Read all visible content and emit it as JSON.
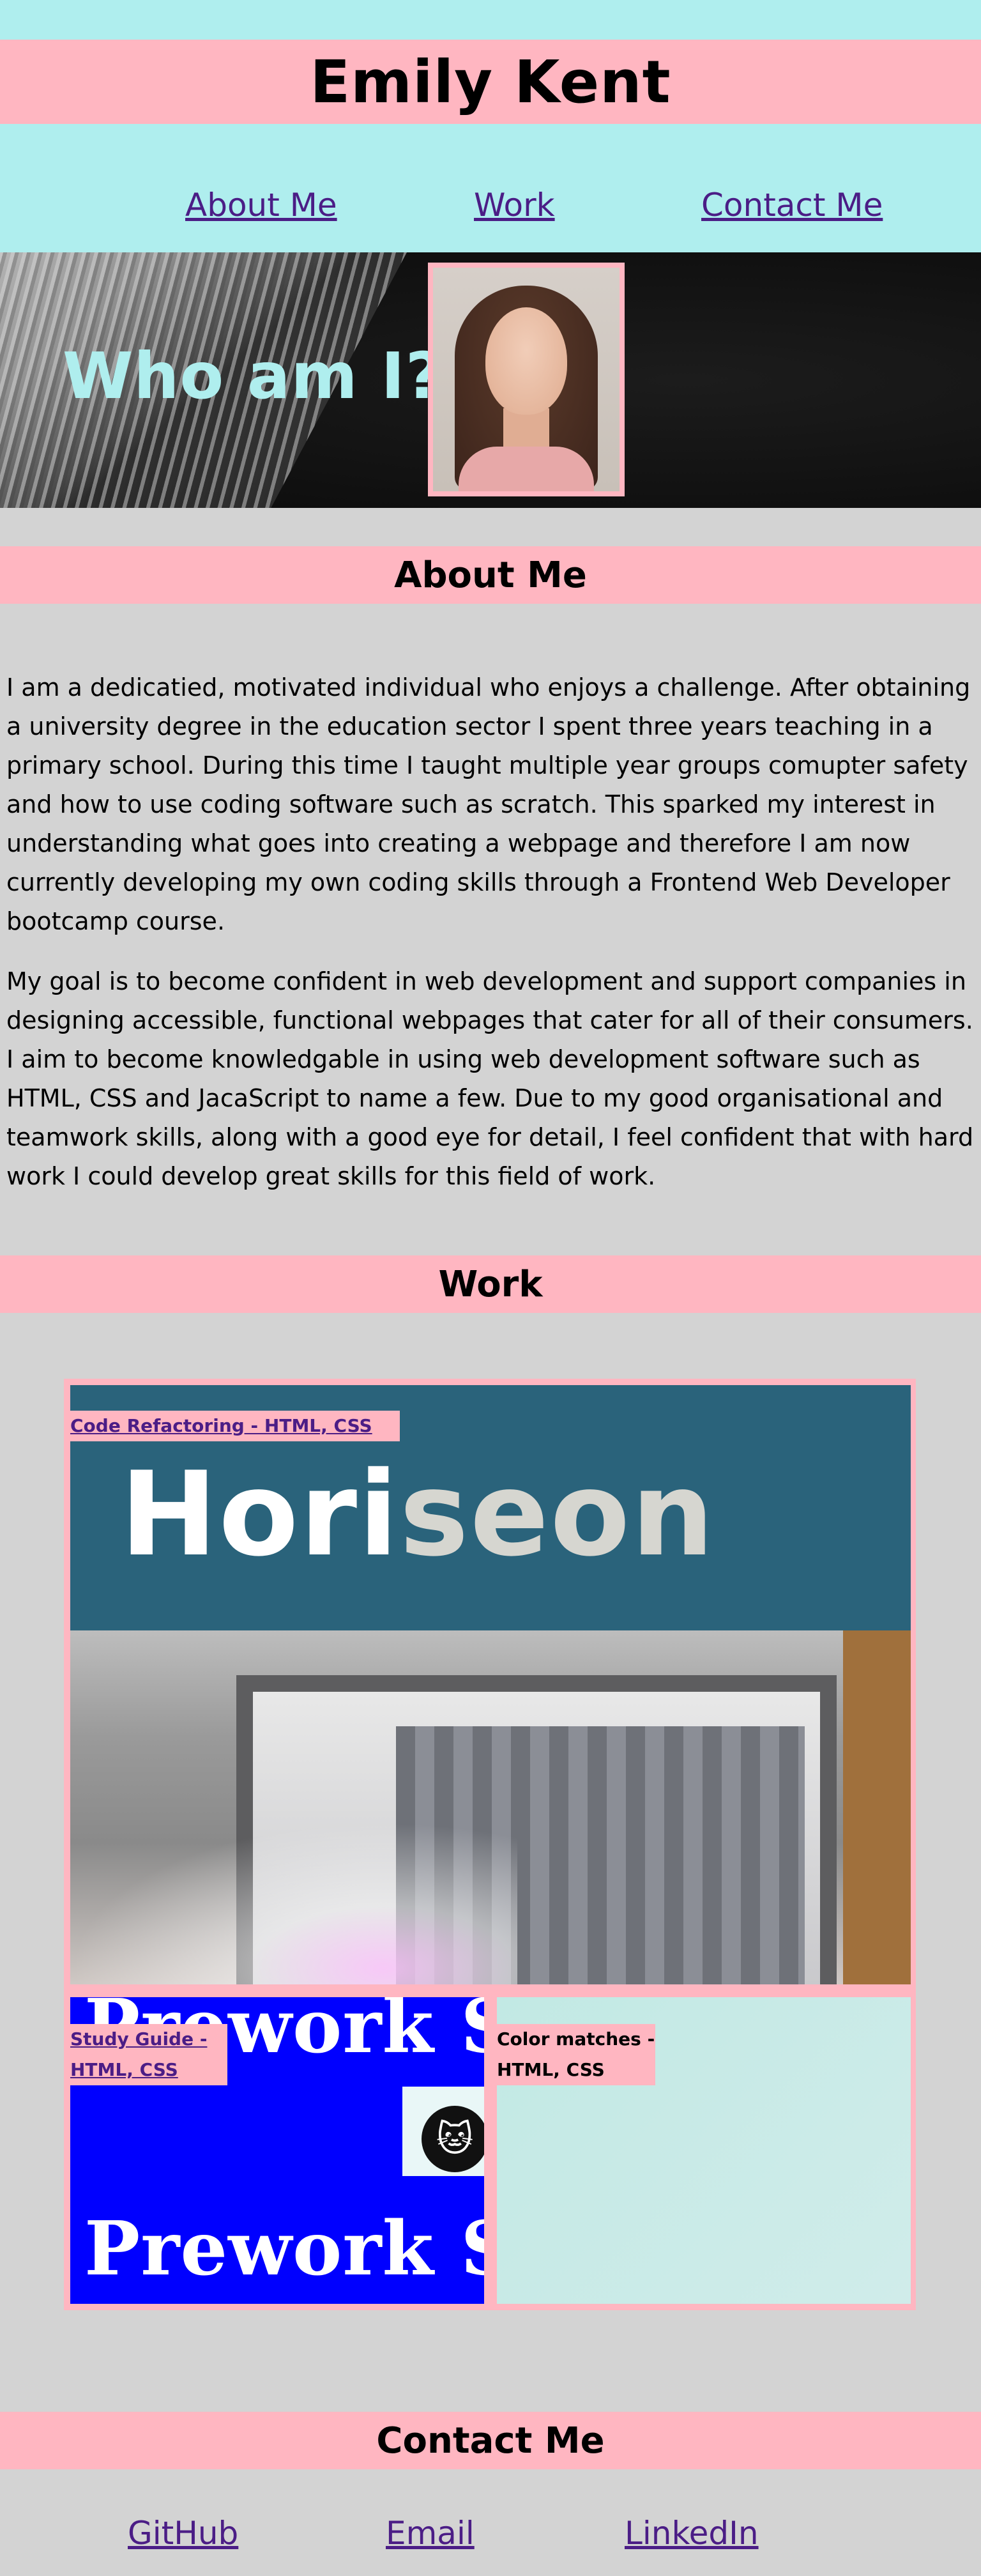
{
  "header": {
    "name": "Emily Kent"
  },
  "nav": {
    "about": "About Me",
    "work": "Work",
    "contact": "Contact Me"
  },
  "hero": {
    "title": "Who am I?"
  },
  "about": {
    "heading": "About Me",
    "paragraph1": "I am a dedicatied, motivated individual who enjoys a challenge. After obtaining a university degree in the education sector I spent three years teaching in a primary school. During this time I taught multiple year groups comupter safety and how to use coding software such as scratch. This sparked my interest in understanding what goes into creating a webpage and therefore I am now currently developing my own coding skills through a Frontend Web Developer bootcamp course.",
    "paragraph2": "My goal is to become confident in web development and support companies in designing accessible, functional webpages that cater for all of their consumers. I aim to become knowledgable in using web development software such as HTML, CSS and JacaScript to name a few. Due to my good organisational and teamwork skills, along with a good eye for detail, I feel confident that with hard work I could develop great skills for this field of work."
  },
  "work": {
    "heading": "Work",
    "projects": [
      {
        "label": "Code Refactoring - HTML, CSS",
        "logo_left": "Hori",
        "logo_right": "seon"
      },
      {
        "label": "Study Guide - HTML, CSS",
        "banner": "Prework Study Guide"
      },
      {
        "label": "Color matches - HTML, CSS"
      }
    ]
  },
  "contact": {
    "heading": "Contact Me",
    "links": [
      "GitHub",
      "Email",
      "LinkedIn"
    ]
  },
  "colors": {
    "accent_pink": "#ffb6c1",
    "accent_cyan": "#afeeee",
    "background": "#d3d3d3",
    "link": "#4b1d86"
  }
}
